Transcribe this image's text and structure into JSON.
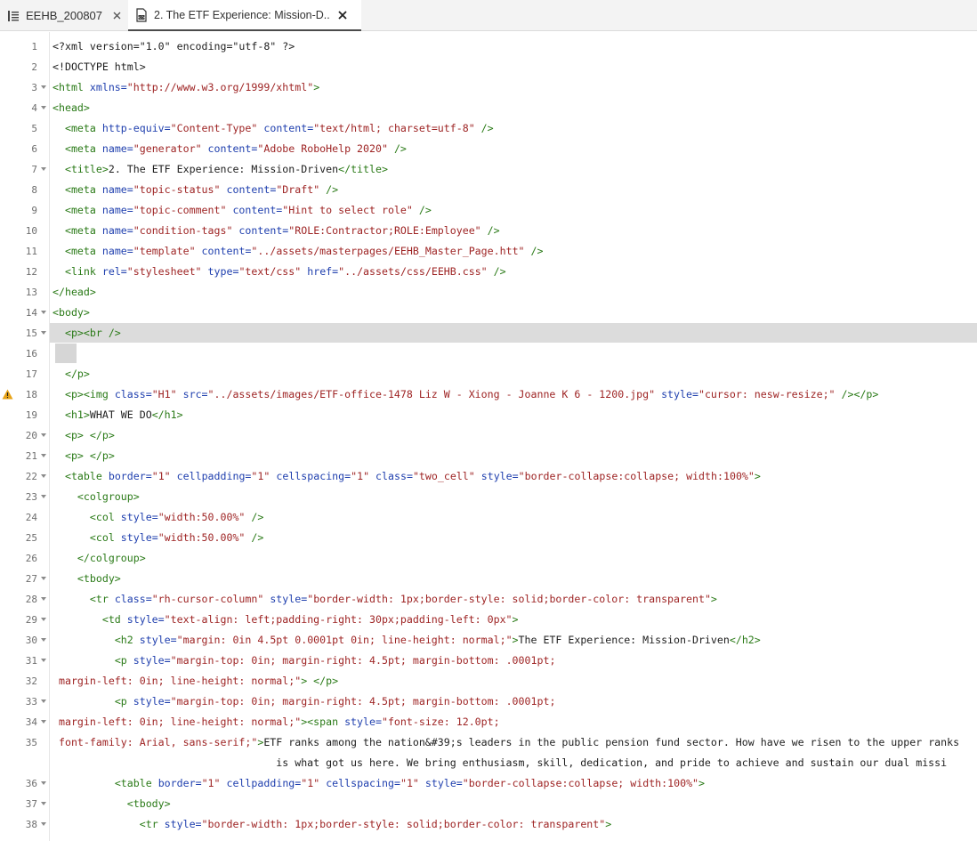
{
  "tabs": [
    {
      "label": "EEHB_200807",
      "icon": "toc-icon",
      "close": "✕"
    },
    {
      "label": "2. The ETF Experience: Mission-D...",
      "icon": "html-file-icon",
      "close": "✕"
    }
  ],
  "editor": {
    "lines": [
      {
        "n": "1",
        "fold": false,
        "warn": false,
        "segs": [
          [
            "t",
            "<?xml version=\"1.0\" encoding=\"utf-8\" ?>"
          ]
        ]
      },
      {
        "n": "2",
        "fold": false,
        "warn": false,
        "segs": [
          [
            "t",
            "<!DOCTYPE html>"
          ]
        ]
      },
      {
        "n": "3",
        "fold": true,
        "warn": false,
        "segs": [
          [
            "g",
            "<html "
          ],
          [
            "a",
            "xmlns="
          ],
          [
            "v",
            "\"http://www.w3.org/1999/xhtml\""
          ],
          [
            "g",
            ">"
          ]
        ]
      },
      {
        "n": "4",
        "fold": true,
        "warn": false,
        "segs": [
          [
            "g",
            "<head>"
          ]
        ]
      },
      {
        "n": "5",
        "fold": false,
        "warn": false,
        "segs": [
          [
            "t",
            "  "
          ],
          [
            "g",
            "<meta "
          ],
          [
            "a",
            "http-equiv="
          ],
          [
            "v",
            "\"Content-Type\""
          ],
          [
            "a",
            " content="
          ],
          [
            "v",
            "\"text/html; charset=utf-8\""
          ],
          [
            "g",
            " />"
          ]
        ]
      },
      {
        "n": "6",
        "fold": false,
        "warn": false,
        "segs": [
          [
            "t",
            "  "
          ],
          [
            "g",
            "<meta "
          ],
          [
            "a",
            "name="
          ],
          [
            "v",
            "\"generator\""
          ],
          [
            "a",
            " content="
          ],
          [
            "v",
            "\"Adobe RoboHelp 2020\""
          ],
          [
            "g",
            " />"
          ]
        ]
      },
      {
        "n": "7",
        "fold": true,
        "warn": false,
        "segs": [
          [
            "t",
            "  "
          ],
          [
            "g",
            "<title>"
          ],
          [
            "t",
            "2. The ETF Experience: Mission-Driven"
          ],
          [
            "g",
            "</title>"
          ]
        ]
      },
      {
        "n": "8",
        "fold": false,
        "warn": false,
        "segs": [
          [
            "t",
            "  "
          ],
          [
            "g",
            "<meta "
          ],
          [
            "a",
            "name="
          ],
          [
            "v",
            "\"topic-status\""
          ],
          [
            "a",
            " content="
          ],
          [
            "v",
            "\"Draft\""
          ],
          [
            "g",
            " />"
          ]
        ]
      },
      {
        "n": "9",
        "fold": false,
        "warn": false,
        "segs": [
          [
            "t",
            "  "
          ],
          [
            "g",
            "<meta "
          ],
          [
            "a",
            "name="
          ],
          [
            "v",
            "\"topic-comment\""
          ],
          [
            "a",
            " content="
          ],
          [
            "v",
            "\"Hint to select role\""
          ],
          [
            "g",
            " />"
          ]
        ]
      },
      {
        "n": "10",
        "fold": false,
        "warn": false,
        "segs": [
          [
            "t",
            "  "
          ],
          [
            "g",
            "<meta "
          ],
          [
            "a",
            "name="
          ],
          [
            "v",
            "\"condition-tags\""
          ],
          [
            "a",
            " content="
          ],
          [
            "v",
            "\"ROLE:Contractor;ROLE:Employee\""
          ],
          [
            "g",
            " />"
          ]
        ]
      },
      {
        "n": "11",
        "fold": false,
        "warn": false,
        "segs": [
          [
            "t",
            "  "
          ],
          [
            "g",
            "<meta "
          ],
          [
            "a",
            "name="
          ],
          [
            "v",
            "\"template\""
          ],
          [
            "a",
            " content="
          ],
          [
            "v",
            "\"../assets/masterpages/EEHB_Master_Page.htt\""
          ],
          [
            "g",
            " />"
          ]
        ]
      },
      {
        "n": "12",
        "fold": false,
        "warn": false,
        "segs": [
          [
            "t",
            "  "
          ],
          [
            "g",
            "<link "
          ],
          [
            "a",
            "rel="
          ],
          [
            "v",
            "\"stylesheet\""
          ],
          [
            "a",
            " type="
          ],
          [
            "v",
            "\"text/css\""
          ],
          [
            "a",
            " href="
          ],
          [
            "v",
            "\"../assets/css/EEHB.css\""
          ],
          [
            "g",
            " />"
          ]
        ]
      },
      {
        "n": "13",
        "fold": false,
        "warn": false,
        "segs": [
          [
            "g",
            "</head>"
          ]
        ]
      },
      {
        "n": "14",
        "fold": true,
        "warn": false,
        "segs": [
          [
            "g",
            "<body>"
          ]
        ]
      },
      {
        "n": "15",
        "fold": true,
        "warn": false,
        "segs": [
          [
            "t",
            "  "
          ],
          [
            "g",
            "<p><br />"
          ]
        ]
      },
      {
        "n": "16",
        "fold": false,
        "warn": false,
        "segs": []
      },
      {
        "n": "17",
        "fold": false,
        "warn": false,
        "segs": [
          [
            "t",
            "  "
          ],
          [
            "g",
            "</p>"
          ]
        ]
      },
      {
        "n": "18",
        "fold": false,
        "warn": true,
        "segs": [
          [
            "t",
            "  "
          ],
          [
            "g",
            "<p><img "
          ],
          [
            "a",
            "class="
          ],
          [
            "v",
            "\"H1\""
          ],
          [
            "a",
            " src="
          ],
          [
            "v",
            "\"../assets/images/ETF-office-1478 Liz W - Xiong - Joanne K 6 - 1200.jpg\""
          ],
          [
            "a",
            " style="
          ],
          [
            "v",
            "\"cursor: nesw-resize;\""
          ],
          [
            "g",
            " /></p>"
          ]
        ]
      },
      {
        "n": "19",
        "fold": false,
        "warn": false,
        "segs": [
          [
            "t",
            "  "
          ],
          [
            "g",
            "<h1>"
          ],
          [
            "t",
            "WHAT WE DO"
          ],
          [
            "g",
            "</h1>"
          ]
        ]
      },
      {
        "n": "20",
        "fold": true,
        "warn": false,
        "segs": [
          [
            "t",
            "  "
          ],
          [
            "g",
            "<p>"
          ],
          [
            "t",
            " "
          ],
          [
            "g",
            "</p>"
          ]
        ]
      },
      {
        "n": "21",
        "fold": true,
        "warn": false,
        "segs": [
          [
            "t",
            "  "
          ],
          [
            "g",
            "<p>"
          ],
          [
            "t",
            " "
          ],
          [
            "g",
            "</p>"
          ]
        ]
      },
      {
        "n": "22",
        "fold": true,
        "warn": false,
        "segs": [
          [
            "t",
            "  "
          ],
          [
            "g",
            "<table "
          ],
          [
            "a",
            "border="
          ],
          [
            "v",
            "\"1\""
          ],
          [
            "a",
            " cellpadding="
          ],
          [
            "v",
            "\"1\""
          ],
          [
            "a",
            " cellspacing="
          ],
          [
            "v",
            "\"1\""
          ],
          [
            "a",
            " class="
          ],
          [
            "v",
            "\"two_cell\""
          ],
          [
            "a",
            " style="
          ],
          [
            "v",
            "\"border-collapse:collapse; width:100%\""
          ],
          [
            "g",
            ">"
          ]
        ]
      },
      {
        "n": "23",
        "fold": true,
        "warn": false,
        "segs": [
          [
            "t",
            "    "
          ],
          [
            "g",
            "<colgroup>"
          ]
        ]
      },
      {
        "n": "24",
        "fold": false,
        "warn": false,
        "segs": [
          [
            "t",
            "      "
          ],
          [
            "g",
            "<col "
          ],
          [
            "a",
            "style="
          ],
          [
            "v",
            "\"width:50.00%\""
          ],
          [
            "g",
            " />"
          ]
        ]
      },
      {
        "n": "25",
        "fold": false,
        "warn": false,
        "segs": [
          [
            "t",
            "      "
          ],
          [
            "g",
            "<col "
          ],
          [
            "a",
            "style="
          ],
          [
            "v",
            "\"width:50.00%\""
          ],
          [
            "g",
            " />"
          ]
        ]
      },
      {
        "n": "26",
        "fold": false,
        "warn": false,
        "segs": [
          [
            "t",
            "    "
          ],
          [
            "g",
            "</colgroup>"
          ]
        ]
      },
      {
        "n": "27",
        "fold": true,
        "warn": false,
        "segs": [
          [
            "t",
            "    "
          ],
          [
            "g",
            "<tbody>"
          ]
        ]
      },
      {
        "n": "28",
        "fold": true,
        "warn": false,
        "segs": [
          [
            "t",
            "      "
          ],
          [
            "g",
            "<tr "
          ],
          [
            "a",
            "class="
          ],
          [
            "v",
            "\"rh-cursor-column\""
          ],
          [
            "a",
            " style="
          ],
          [
            "v",
            "\"border-width: 1px;border-style: solid;border-color: transparent\""
          ],
          [
            "g",
            ">"
          ]
        ]
      },
      {
        "n": "29",
        "fold": true,
        "warn": false,
        "segs": [
          [
            "t",
            "        "
          ],
          [
            "g",
            "<td "
          ],
          [
            "a",
            "style="
          ],
          [
            "v",
            "\"text-align: left;padding-right: 30px;padding-left: 0px\""
          ],
          [
            "g",
            ">"
          ]
        ]
      },
      {
        "n": "30",
        "fold": true,
        "warn": false,
        "segs": [
          [
            "t",
            "          "
          ],
          [
            "g",
            "<h2 "
          ],
          [
            "a",
            "style="
          ],
          [
            "v",
            "\"margin: 0in 4.5pt 0.0001pt 0in; line-height: normal;\""
          ],
          [
            "g",
            ">"
          ],
          [
            "t",
            "The ETF Experience: Mission-Driven"
          ],
          [
            "g",
            "</h2>"
          ]
        ]
      },
      {
        "n": "31",
        "fold": true,
        "warn": false,
        "segs": [
          [
            "t",
            "          "
          ],
          [
            "g",
            "<p "
          ],
          [
            "a",
            "style="
          ],
          [
            "v",
            "\"margin-top: 0in; margin-right: 4.5pt; margin-bottom: .0001pt;"
          ]
        ]
      },
      {
        "n": "32",
        "fold": false,
        "warn": false,
        "segs": [
          [
            "v",
            " margin-left: 0in; line-height: normal;\""
          ],
          [
            "g",
            ">"
          ],
          [
            "t",
            " "
          ],
          [
            "g",
            "</p>"
          ]
        ]
      },
      {
        "n": "33",
        "fold": true,
        "warn": false,
        "segs": [
          [
            "t",
            "          "
          ],
          [
            "g",
            "<p "
          ],
          [
            "a",
            "style="
          ],
          [
            "v",
            "\"margin-top: 0in; margin-right: 4.5pt; margin-bottom: .0001pt;"
          ]
        ]
      },
      {
        "n": "34",
        "fold": true,
        "warn": false,
        "segs": [
          [
            "v",
            " margin-left: 0in; line-height: normal;\""
          ],
          [
            "g",
            "><span "
          ],
          [
            "a",
            "style="
          ],
          [
            "v",
            "\"font-size: 12.0pt;"
          ]
        ]
      },
      {
        "n": "35",
        "fold": false,
        "warn": false,
        "segs": [
          [
            "v",
            " font-family: Arial, sans-serif;\""
          ],
          [
            "g",
            ">"
          ],
          [
            "t",
            "ETF ranks among the nation&#39;s leaders in the public pension fund sector. How have we risen to the upper ranks"
          ]
        ]
      },
      {
        "n": "",
        "fold": false,
        "warn": false,
        "segs": [
          [
            "t",
            "                                    is what got us here. We bring enthusiasm, skill, dedication, and pride to achieve and sustain our dual missi"
          ]
        ]
      },
      {
        "n": "36",
        "fold": true,
        "warn": false,
        "segs": [
          [
            "t",
            "          "
          ],
          [
            "g",
            "<table "
          ],
          [
            "a",
            "border="
          ],
          [
            "v",
            "\"1\""
          ],
          [
            "a",
            " cellpadding="
          ],
          [
            "v",
            "\"1\""
          ],
          [
            "a",
            " cellspacing="
          ],
          [
            "v",
            "\"1\""
          ],
          [
            "a",
            " style="
          ],
          [
            "v",
            "\"border-collapse:collapse; width:100%\""
          ],
          [
            "g",
            ">"
          ]
        ]
      },
      {
        "n": "37",
        "fold": true,
        "warn": false,
        "segs": [
          [
            "t",
            "            "
          ],
          [
            "g",
            "<tbody>"
          ]
        ]
      },
      {
        "n": "38",
        "fold": true,
        "warn": false,
        "segs": [
          [
            "t",
            "              "
          ],
          [
            "g",
            "<tr "
          ],
          [
            "a",
            "style="
          ],
          [
            "v",
            "\"border-width: 1px;border-style: solid;border-color: transparent\""
          ],
          [
            "g",
            ">"
          ]
        ]
      }
    ]
  }
}
